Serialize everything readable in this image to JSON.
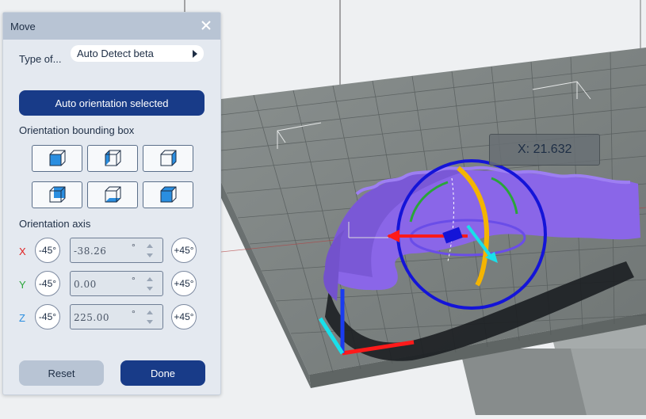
{
  "panel": {
    "title": "Move",
    "type_label": "Type of...",
    "type_value": "Auto Detect beta",
    "auto_orient_button": "Auto orientation selected",
    "bbox_label": "Orientation bounding box",
    "axis_label": "Orientation axis",
    "axes": [
      {
        "letter": "X",
        "color": "#e02020",
        "minus": "-45°",
        "value": "-38.26",
        "unit": "°",
        "plus": "+45°"
      },
      {
        "letter": "Y",
        "color": "#2aa53a",
        "minus": "-45°",
        "value": "0.00",
        "unit": "°",
        "plus": "+45°"
      },
      {
        "letter": "Z",
        "color": "#2a8ee0",
        "minus": "-45°",
        "value": "225.00",
        "unit": "°",
        "plus": "+45°"
      }
    ],
    "reset_button": "Reset",
    "done_button": "Done"
  },
  "viewport": {
    "readout": "X: 21.632",
    "model_color": "#8a66e8",
    "platform_color": "#7a807f"
  },
  "colors": {
    "accent": "#183b88",
    "axis_x": "#ff1a1a",
    "axis_y": "#2aa53a",
    "axis_z": "#1a3cf0",
    "ring": "#1414d8",
    "ring_yellow": "#f4b400",
    "cyan": "#19e0ea"
  }
}
